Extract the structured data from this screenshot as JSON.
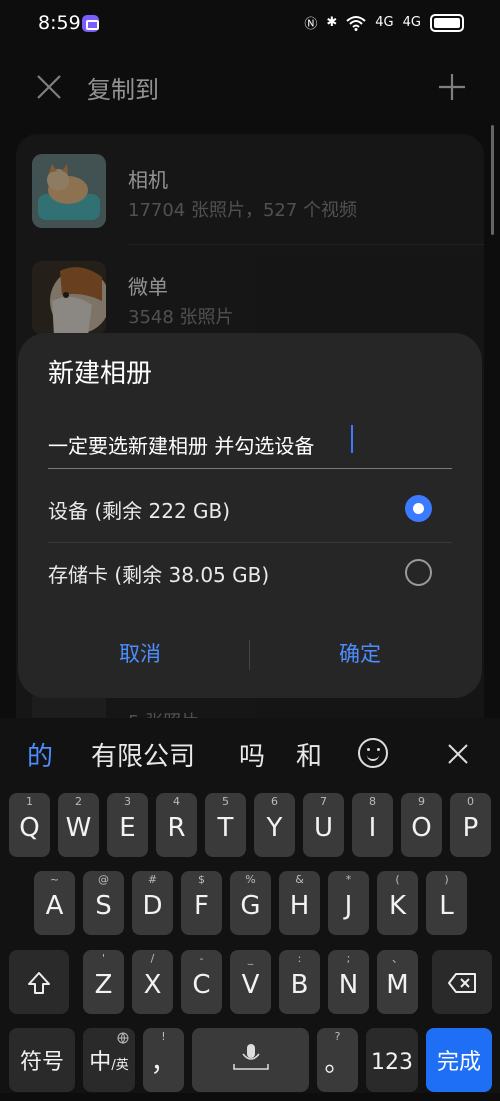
{
  "status_bar": {
    "time": "8:59",
    "network_1": "4G",
    "network_2": "4G"
  },
  "header": {
    "title": "复制到"
  },
  "albums": [
    {
      "name": "相机",
      "meta": "17704 张照片，527 个视频"
    },
    {
      "name": "微单",
      "meta": "3548 张照片"
    },
    {
      "name": "",
      "meta": "5 张照片"
    }
  ],
  "dialog": {
    "title": "新建相册",
    "input_value": "一定要选新建相册 并勾选设备",
    "options": [
      {
        "label": "设备 (剩余 222 GB)",
        "selected": true
      },
      {
        "label": "存储卡 (剩余 38.05 GB)",
        "selected": false
      }
    ],
    "cancel_label": "取消",
    "confirm_label": "确定"
  },
  "keyboard": {
    "suggestions": [
      "的",
      "有限公司",
      "吗",
      "和"
    ],
    "row1": [
      {
        "k": "Q",
        "h": "1"
      },
      {
        "k": "W",
        "h": "2"
      },
      {
        "k": "E",
        "h": "3"
      },
      {
        "k": "R",
        "h": "4"
      },
      {
        "k": "T",
        "h": "5"
      },
      {
        "k": "Y",
        "h": "6"
      },
      {
        "k": "U",
        "h": "7"
      },
      {
        "k": "I",
        "h": "8"
      },
      {
        "k": "O",
        "h": "9"
      },
      {
        "k": "P",
        "h": "0"
      }
    ],
    "row2": [
      {
        "k": "A",
        "h": "~"
      },
      {
        "k": "S",
        "h": "@"
      },
      {
        "k": "D",
        "h": "#"
      },
      {
        "k": "F",
        "h": "$"
      },
      {
        "k": "G",
        "h": "%"
      },
      {
        "k": "H",
        "h": "&"
      },
      {
        "k": "J",
        "h": "*"
      },
      {
        "k": "K",
        "h": "("
      },
      {
        "k": "L",
        "h": ")"
      }
    ],
    "row3": [
      {
        "k": "Z",
        "h": "'"
      },
      {
        "k": "X",
        "h": "/"
      },
      {
        "k": "C",
        "h": "-"
      },
      {
        "k": "V",
        "h": "_"
      },
      {
        "k": "B",
        "h": ":"
      },
      {
        "k": "N",
        "h": ";"
      },
      {
        "k": "M",
        "h": "、"
      }
    ],
    "symbols_label": "符号",
    "lang_label": "中",
    "lang_sub": "/英",
    "comma": "，",
    "comma_hint": "!",
    "period": "。",
    "period_hint": "?",
    "num_label": "123",
    "done_label": "完成"
  },
  "colors": {
    "accent": "#3b7bff",
    "link": "#4d8dff",
    "dialog_bg": "#262626",
    "key_bg": "#3a3a3a"
  }
}
